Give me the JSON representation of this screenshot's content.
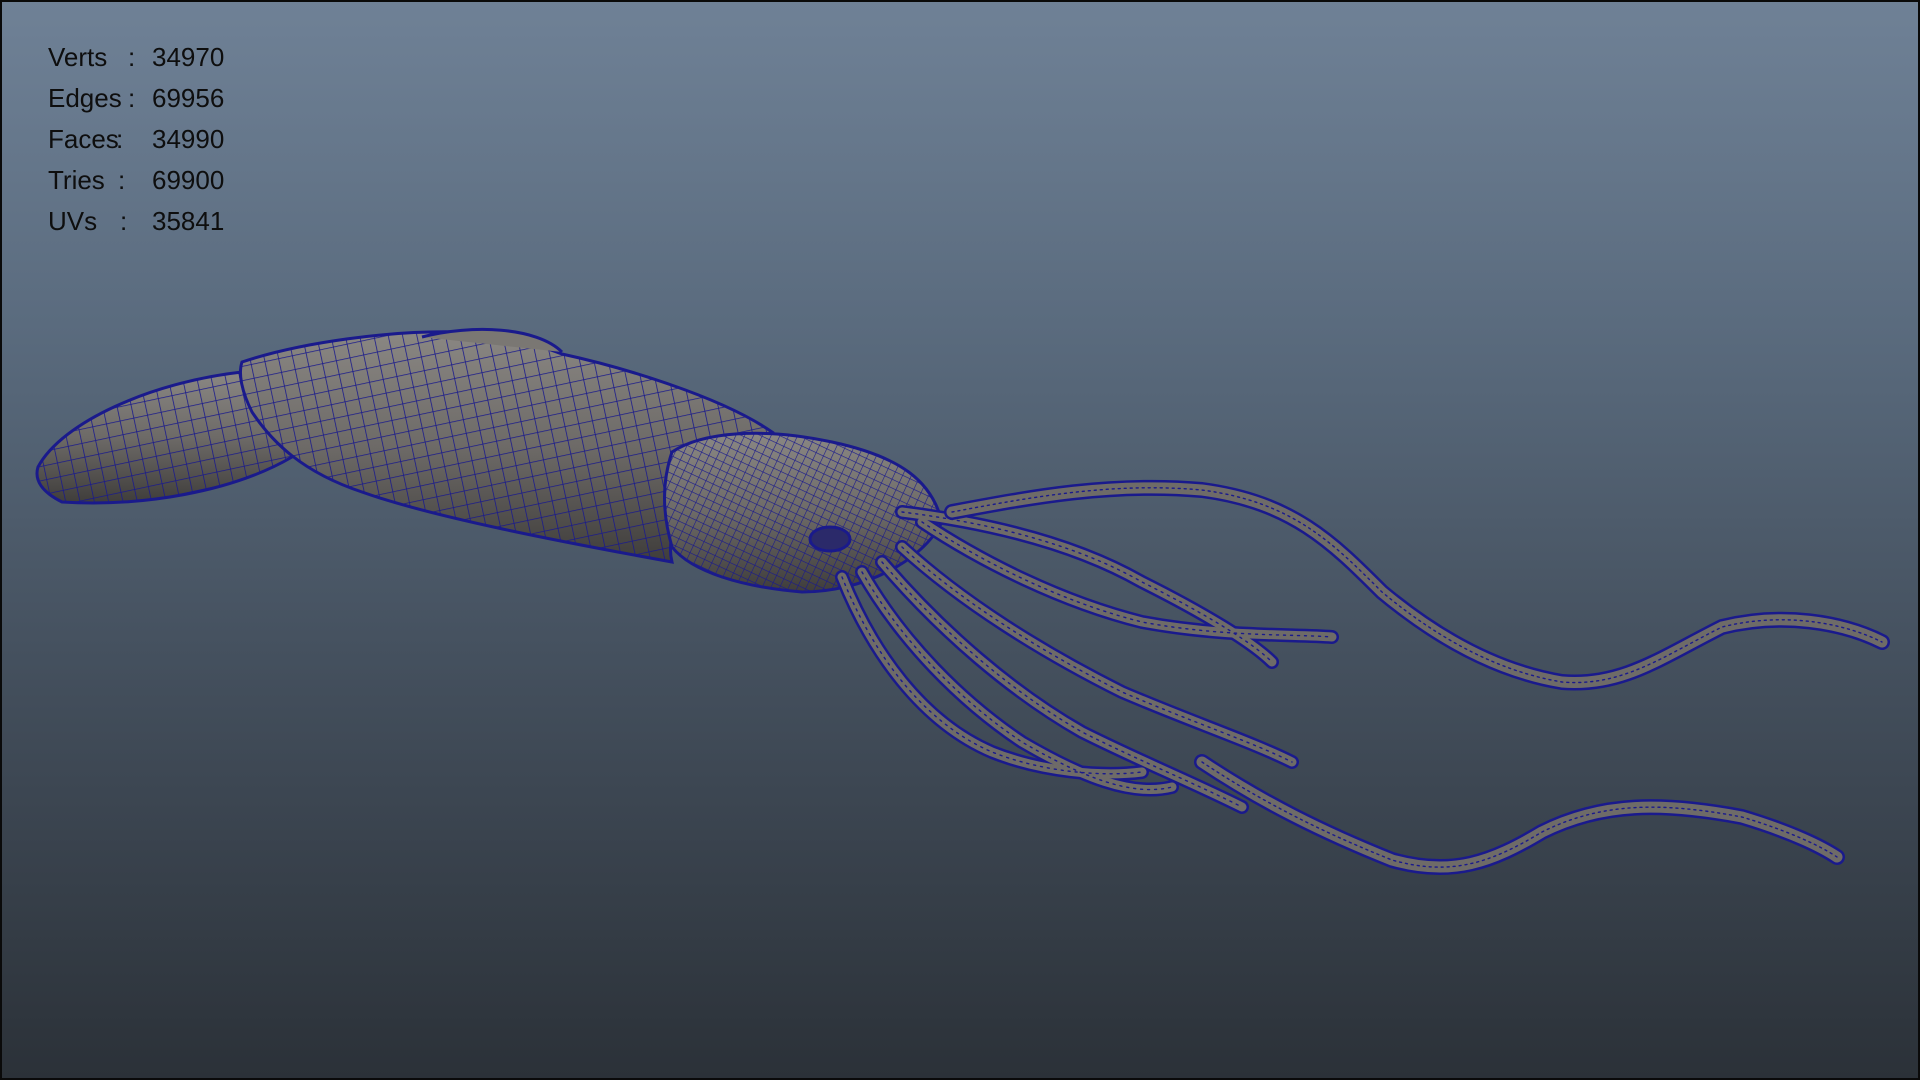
{
  "hud": {
    "stats": [
      {
        "label": "Verts",
        "colon": ":",
        "value": "34970"
      },
      {
        "label": "Edges",
        "colon": ":",
        "value": "69956"
      },
      {
        "label": "Faces",
        "colon": ":",
        "value": "34990"
      },
      {
        "label": "Tries",
        "colon": ":",
        "value": "69900"
      },
      {
        "label": "UVs",
        "colon": ":",
        "value": "35841"
      }
    ]
  },
  "mesh": {
    "subject": "squid wireframe model",
    "fill_color": "#6e6b68",
    "wire_color": "#1a1a8c"
  }
}
